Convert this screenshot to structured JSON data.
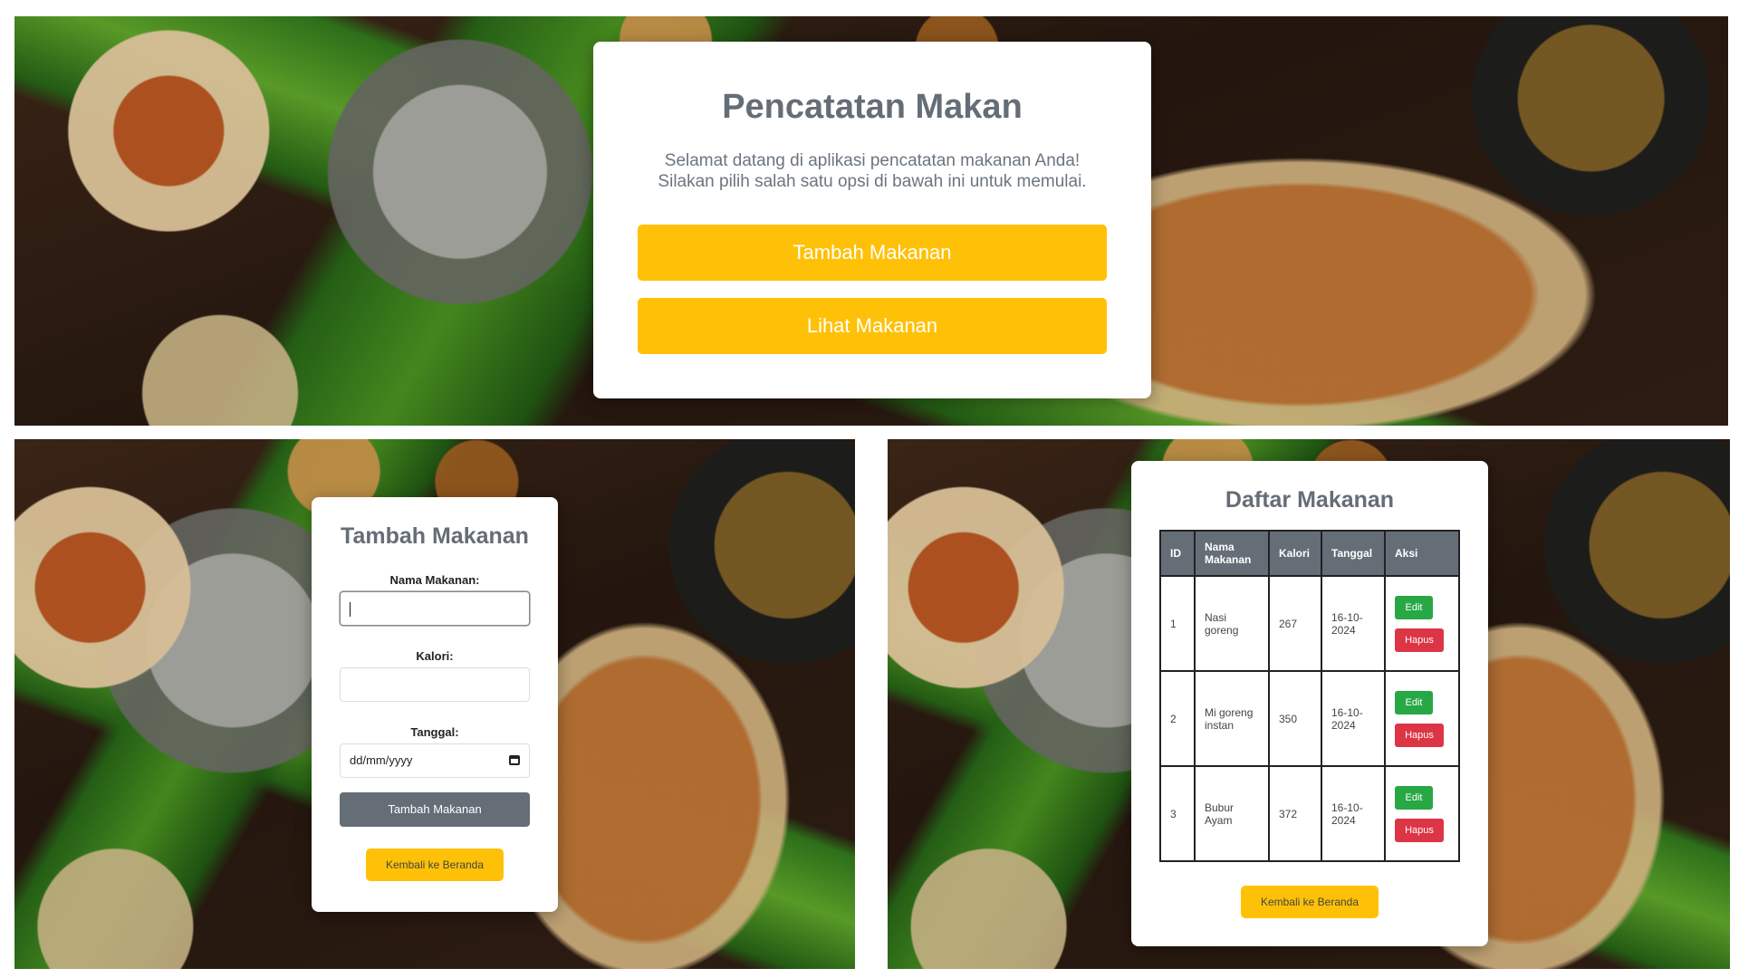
{
  "home": {
    "title": "Pencatatan Makan",
    "welcome_line1": "Selamat datang di aplikasi pencatatan makanan Anda!",
    "welcome_line2": "Silakan pilih salah satu opsi di bawah ini untuk memulai.",
    "add_button": "Tambah Makanan",
    "view_button": "Lihat Makanan"
  },
  "add_form": {
    "title": "Tambah Makanan",
    "name_label": "Nama Makanan:",
    "name_value": "",
    "calories_label": "Kalori:",
    "calories_value": "",
    "date_label": "Tanggal:",
    "date_placeholder": "dd/mm/yyyy",
    "submit_button": "Tambah Makanan",
    "back_button": "Kembali ke Beranda"
  },
  "food_list": {
    "title": "Daftar Makanan",
    "columns": [
      "ID",
      "Nama Makanan",
      "Kalori",
      "Tanggal",
      "Aksi"
    ],
    "rows": [
      {
        "id": "1",
        "name": "Nasi goreng",
        "calories": "267",
        "date": "16-10-2024"
      },
      {
        "id": "2",
        "name": "Mi goreng instan",
        "calories": "350",
        "date": "16-10-2024"
      },
      {
        "id": "3",
        "name": "Bubur Ayam",
        "calories": "372",
        "date": "16-10-2024"
      }
    ],
    "edit_label": "Edit",
    "delete_label": "Hapus",
    "back_button": "Kembali ke Beranda"
  },
  "colors": {
    "accent_yellow": "#ffc107",
    "title_gray": "#656d77",
    "edit_green": "#28a745",
    "delete_red": "#dc3545"
  },
  "icons": {
    "date_picker": "calendar-icon"
  }
}
